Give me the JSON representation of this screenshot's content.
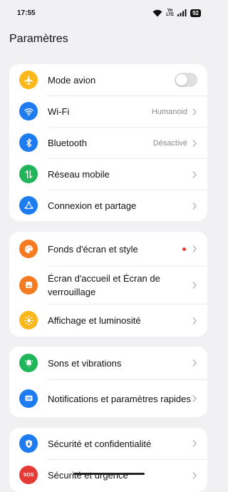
{
  "status_bar": {
    "time": "17:55",
    "volte_top": "Vo",
    "volte_bottom": "LTE",
    "battery": "92"
  },
  "page": {
    "title": "Paramètres"
  },
  "colors": {
    "orange": "#fbb81b",
    "blue": "#1e7bf0",
    "green": "#20b558",
    "deep_orange": "#f47b20",
    "red": "#e53935"
  },
  "groups": [
    {
      "items": [
        {
          "label": "Mode avion",
          "icon": "airplane-icon",
          "control": "toggle",
          "toggle_on": false
        },
        {
          "label": "Wi-Fi",
          "icon": "wifi-icon",
          "value": "Humanoid"
        },
        {
          "label": "Bluetooth",
          "icon": "bluetooth-icon",
          "value": "Désactivé"
        },
        {
          "label": "Réseau mobile",
          "icon": "mobile-data-icon"
        },
        {
          "label": "Connexion et partage",
          "icon": "share-icon"
        }
      ]
    },
    {
      "items": [
        {
          "label": "Fonds d'écran et style",
          "icon": "palette-icon",
          "badge": "dot"
        },
        {
          "label": "Écran d'accueil et Écran de verrouillage",
          "icon": "home-screen-icon"
        },
        {
          "label": "Affichage et luminosité",
          "icon": "brightness-icon"
        }
      ]
    },
    {
      "items": [
        {
          "label": "Sons et vibrations",
          "icon": "bell-icon"
        },
        {
          "label": "Notifications et paramètres rapides",
          "icon": "notification-icon"
        }
      ]
    },
    {
      "items": [
        {
          "label": "Sécurité et confidentialité",
          "icon": "lock-icon"
        },
        {
          "label": "Sécurité et urgence",
          "icon": "sos-icon",
          "icon_text": "SOS"
        }
      ]
    }
  ]
}
